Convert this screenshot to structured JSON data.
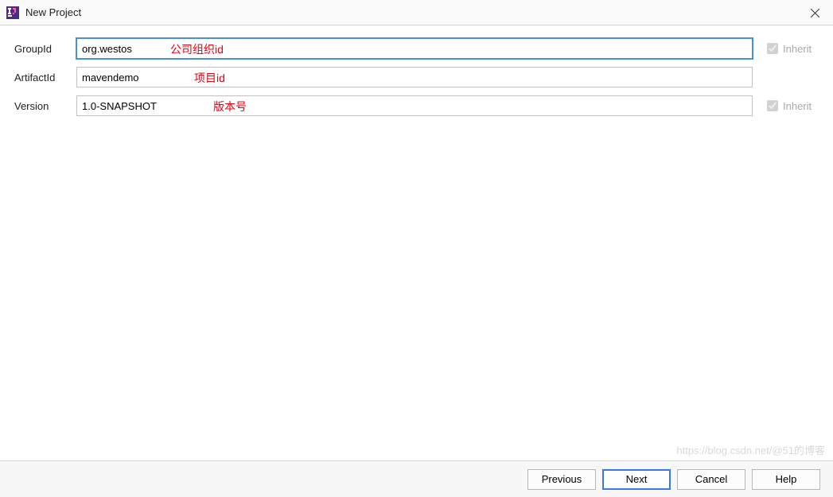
{
  "window": {
    "title": "New Project"
  },
  "form": {
    "groupId": {
      "label": "GroupId",
      "value": "org.westos",
      "annotation": "公司组织id",
      "inherit_label": "Inherit",
      "inherit_checked": true
    },
    "artifactId": {
      "label": "ArtifactId",
      "value": "mavendemo",
      "annotation": "项目id"
    },
    "version": {
      "label": "Version",
      "value": "1.0-SNAPSHOT",
      "annotation": "版本号",
      "inherit_label": "Inherit",
      "inherit_checked": true
    }
  },
  "buttons": {
    "previous": "Previous",
    "next": "Next",
    "cancel": "Cancel",
    "help": "Help"
  },
  "watermark": "https://blog.csdn.net/@51的博客"
}
